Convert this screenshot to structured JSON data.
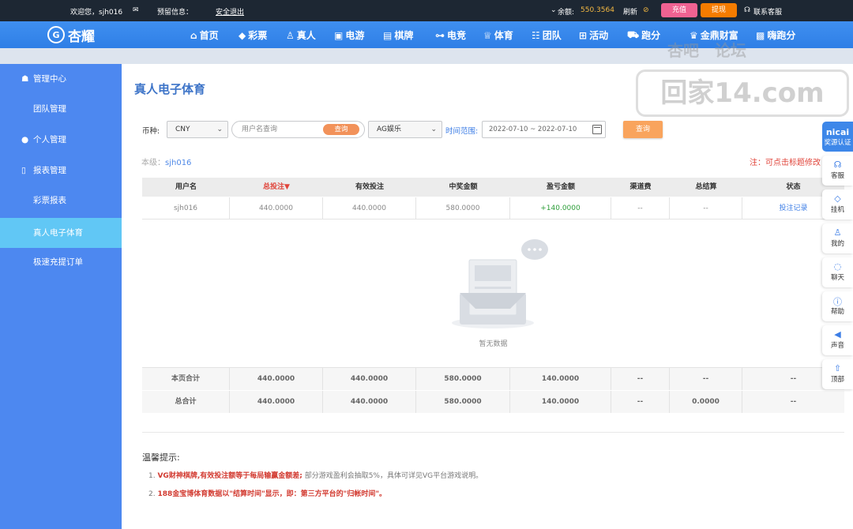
{
  "topbar": {
    "welcome": "欢迎您，sjh016",
    "reserved_info": "预留信息：",
    "logout": "安全退出",
    "balance_label": "余额:",
    "balance_value": "550.3564",
    "refresh": "刷新",
    "recharge": "充值",
    "withdraw": "提现",
    "support": "联系客服"
  },
  "nav": {
    "logo": "杏耀",
    "items": [
      "首页",
      "彩票",
      "真人",
      "电游",
      "棋牌",
      "电竞",
      "体育",
      "团队",
      "活动",
      "跑分",
      "金鼎财富",
      "嗨跑分"
    ]
  },
  "sidebar": {
    "items": [
      {
        "label": "管理中心"
      },
      {
        "label": "团队管理"
      },
      {
        "label": "个人管理"
      },
      {
        "label": "报表管理"
      },
      {
        "label": "彩票报表"
      },
      {
        "label": "真人电子体育"
      },
      {
        "label": "极速充提订单"
      }
    ]
  },
  "main": {
    "title": "真人电子体育",
    "currency_label": "币种:",
    "currency_value": "CNY",
    "search_placeholder": "用户名查询",
    "search_button": "查询",
    "platform_value": "AG娱乐",
    "time_label": "时间范围:",
    "date_range": "2022-07-10 ~ 2022-07-10",
    "query_button": "查询",
    "level_label": "本级：",
    "level_value": "sjh016",
    "note": "注：可点击标题修改"
  },
  "table": {
    "headers": [
      "用户名",
      "总投注▼",
      "有效投注",
      "中奖金额",
      "盈亏金额",
      "渠道费",
      "总结算",
      "状态"
    ],
    "row": [
      "sjh016",
      "440.0000",
      "440.0000",
      "580.0000",
      "+140.0000",
      "--",
      "--",
      "投注记录"
    ],
    "empty_text": "暂无数据",
    "page_total": [
      "本页合计",
      "440.0000",
      "440.0000",
      "580.0000",
      "140.0000",
      "--",
      "--",
      "--"
    ],
    "grand_total": [
      "总合计",
      "440.0000",
      "440.0000",
      "580.0000",
      "140.0000",
      "--",
      "0.0000",
      "--"
    ]
  },
  "tips": {
    "title": "温馨提示:",
    "tip1_num": "1.",
    "tip1_highlight": "VG财神棋牌,有效投注额等于每局输赢金额差;",
    "tip1_rest": " 部分游戏盈利会抽取5%，具体可详见VG平台游戏说明。",
    "tip2_num": "2.",
    "tip2_highlight": "188金宝博体育数据以\"结算时间\"显示，即：第三方平台的\"归帐时间\"。"
  },
  "float_bar": {
    "head_top": "nicai",
    "head_bottom": "奖源认证",
    "items": [
      "客服",
      "挂机",
      "我的",
      "聊天",
      "帮助",
      "声音",
      "顶部"
    ]
  },
  "watermark": {
    "top": "杏吧　论坛",
    "main": "回家14.com"
  }
}
